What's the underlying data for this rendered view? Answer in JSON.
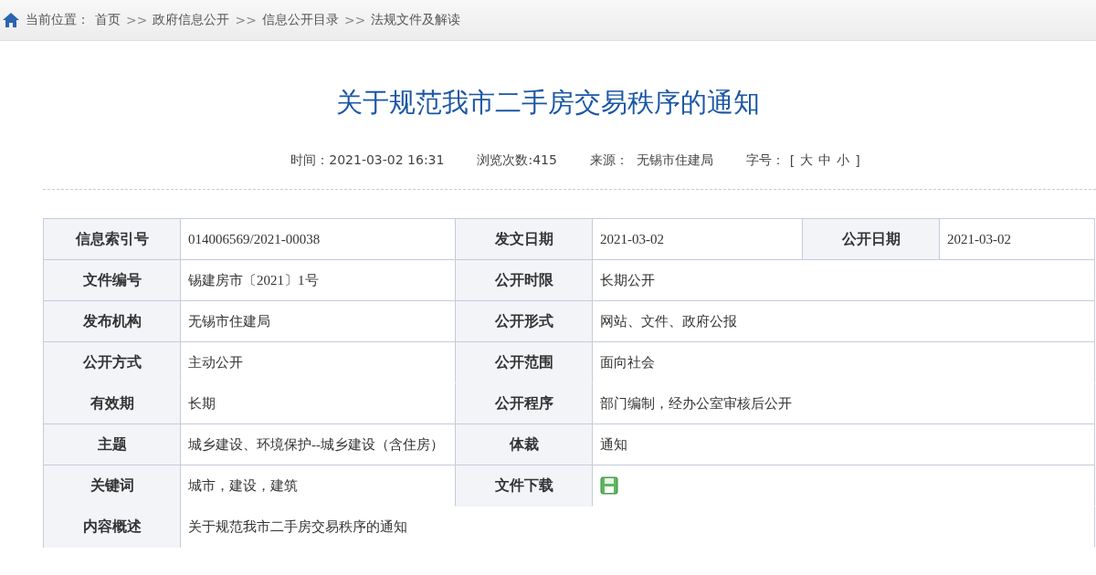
{
  "breadcrumb": {
    "label": "当前位置：",
    "crumbs": [
      {
        "kind": "link",
        "text": "首页"
      },
      {
        "kind": "separator",
        "text": ">>"
      },
      {
        "kind": "link",
        "text": "政府信息公开"
      },
      {
        "kind": "separator",
        "text": ">>"
      },
      {
        "kind": "link",
        "text": "信息公开目录"
      },
      {
        "kind": "separator",
        "text": ">>"
      },
      {
        "kind": "link",
        "text": "法规文件及解读"
      }
    ]
  },
  "article": {
    "title": "关于规范我市二手房交易秩序的通知",
    "meta": [
      {
        "kind": "text",
        "text": "时间：2021-03-02 16:31"
      },
      {
        "kind": "text",
        "text": "浏览次数:415"
      },
      {
        "kind": "text",
        "text": "来源：  无锡市住建局"
      }
    ],
    "font_size": {
      "label": "字号：",
      "open": "[",
      "options": [
        "大",
        "中",
        "小"
      ],
      "close": "]"
    }
  },
  "info_table": {
    "rows": [
      {
        "ruled": true,
        "cells": [
          {
            "label": "信息索引号",
            "kind": "text",
            "value": "014006569/2021-00038"
          },
          {
            "label": "发文日期",
            "kind": "text",
            "value": "2021-03-02"
          },
          {
            "label": "公开日期",
            "kind": "text",
            "value": "2021-03-02"
          }
        ]
      },
      {
        "ruled": true,
        "cells": [
          {
            "label": "文件编号",
            "kind": "text",
            "value": "锡建房市〔2021〕1号"
          },
          {
            "label": "公开时限",
            "kind": "text",
            "value": "长期公开"
          }
        ]
      },
      {
        "ruled": true,
        "cells": [
          {
            "label": "发布机构",
            "kind": "text",
            "value": "无锡市住建局"
          },
          {
            "label": "公开形式",
            "kind": "text",
            "value": "网站、文件、政府公报"
          }
        ]
      },
      {
        "ruled": false,
        "cells": [
          {
            "label": "公开方式",
            "kind": "text",
            "value": "主动公开"
          },
          {
            "label": "公开范围",
            "kind": "text",
            "value": "面向社会"
          }
        ]
      },
      {
        "ruled": true,
        "cells": [
          {
            "label": "有效期",
            "kind": "text",
            "value": "长期"
          },
          {
            "label": "公开程序",
            "kind": "text",
            "value": "部门编制，经办公室审核后公开"
          }
        ]
      },
      {
        "ruled": true,
        "cells": [
          {
            "label": "主题",
            "kind": "text",
            "value": "城乡建设、环境保护--城乡建设（含住房）"
          },
          {
            "label": "体裁",
            "kind": "text",
            "value": "通知"
          }
        ]
      },
      {
        "ruled": false,
        "cells": [
          {
            "label": "关键词",
            "kind": "text",
            "value": "城市，建设，建筑"
          },
          {
            "label": "文件下载",
            "kind": "download"
          }
        ]
      },
      {
        "ruled": false,
        "cells": [
          {
            "label": "内容概述",
            "kind": "text",
            "value": "关于规范我市二手房交易秩序的通知"
          }
        ]
      }
    ]
  }
}
